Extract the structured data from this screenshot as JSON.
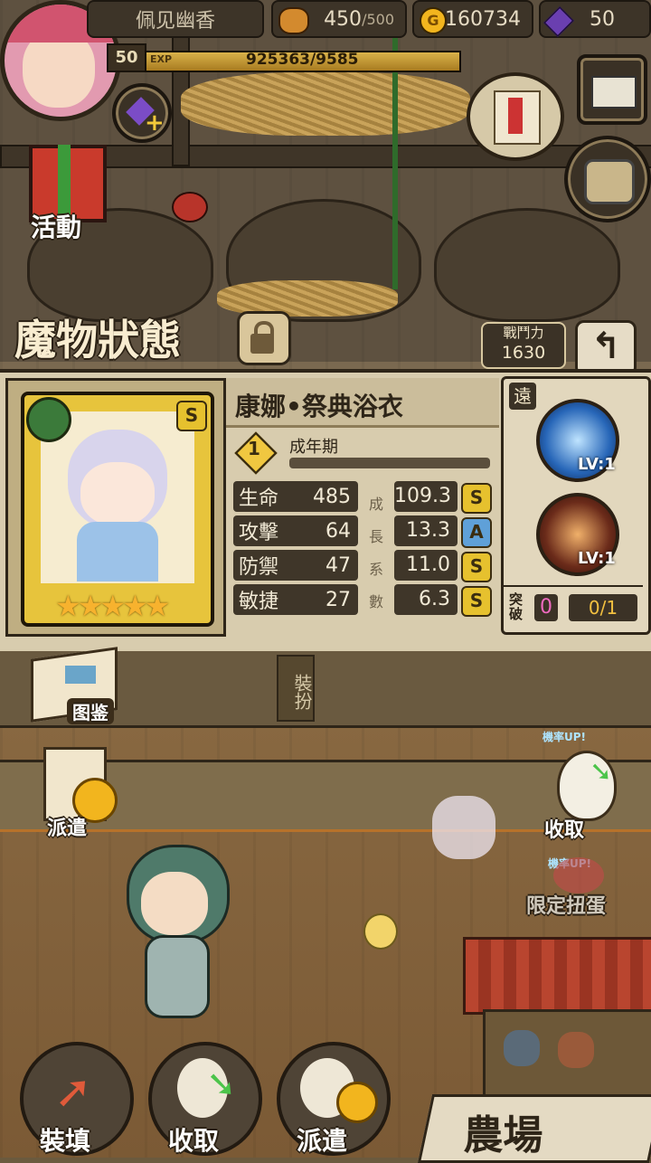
{
  "player": {
    "name": "佩见幽香",
    "level": "50",
    "exp_label": "EXP",
    "exp_text": "925363/9585"
  },
  "resources": {
    "stamina": "450",
    "stamina_max": "/500",
    "gold": "160734",
    "gems": "50",
    "gold_glyph": "G"
  },
  "side_buttons": {
    "event": "活動",
    "codex": "图鉴",
    "dispatch": "派遣",
    "collect": "收取",
    "limited": "限定扭蛋",
    "rate_up": "機率UP!"
  },
  "status": {
    "title": "魔物狀態",
    "power_label": "戰鬥力",
    "power_value": "1630",
    "monster_name": "康娜•祭典浴衣",
    "rarity": "S",
    "stage_num": "1",
    "stage": "成年期",
    "growth_vertical": [
      "成",
      "長",
      "系",
      "數"
    ],
    "stats": [
      {
        "name": "生命",
        "value": "485",
        "growth": "109.3",
        "rank": "S"
      },
      {
        "name": "攻擊",
        "value": "64",
        "growth": "13.3",
        "rank": "A"
      },
      {
        "name": "防禦",
        "value": "47",
        "growth": "11.0",
        "rank": "S"
      },
      {
        "name": "敏捷",
        "value": "27",
        "growth": "6.3",
        "rank": "S"
      }
    ],
    "range": "遠",
    "skills": [
      {
        "level": "LV:1"
      },
      {
        "level": "LV:1"
      }
    ],
    "breakthrough_label": "突破",
    "breakthrough_value": "0",
    "breakthrough_count": "0/1",
    "equip_label": "裝扮"
  },
  "bottom_nav": {
    "load": "裝填",
    "collect": "收取",
    "dispatch": "派遣",
    "farm": "農場"
  },
  "colors": {
    "panel_bg": "#d8ccae",
    "rank_S": "#e6c12e",
    "rank_A": "#5fa0d8",
    "gold": "#f2b51e",
    "gem": "#6a3fb0"
  }
}
